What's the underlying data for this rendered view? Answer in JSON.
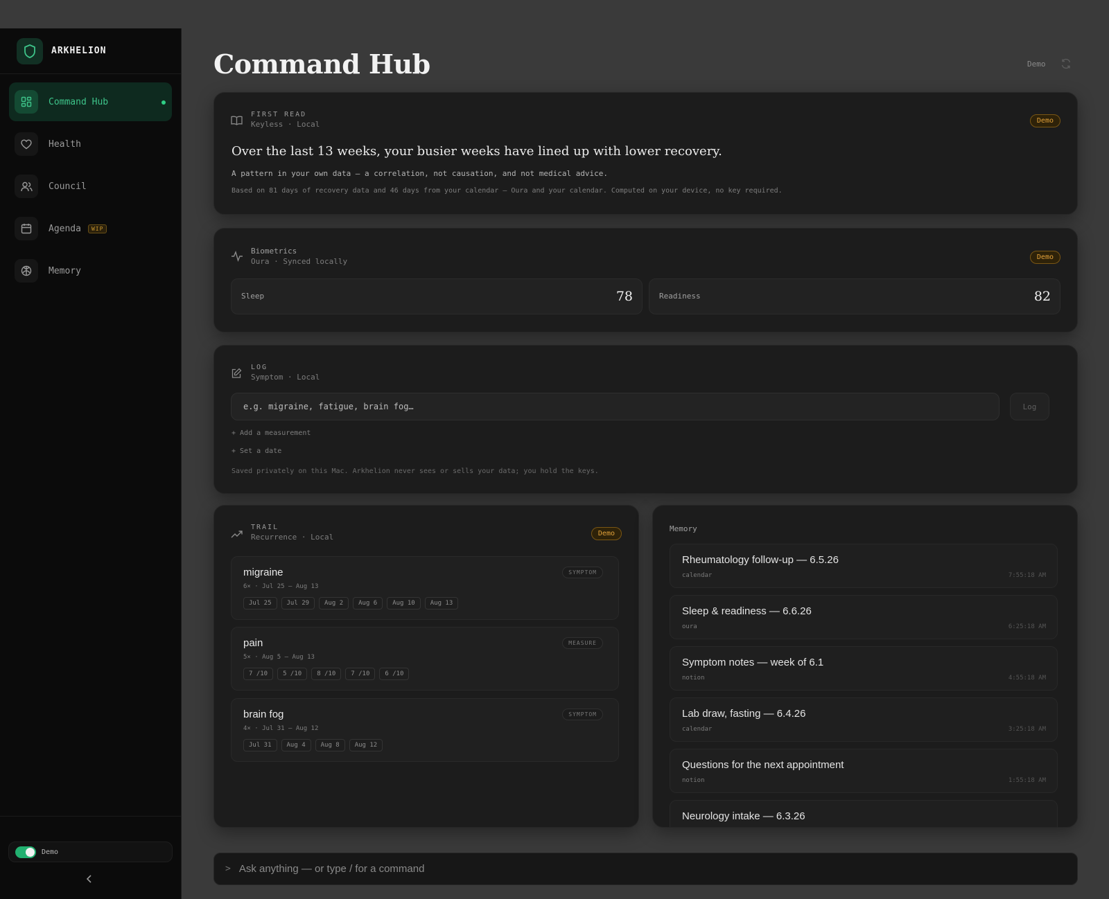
{
  "brand": {
    "name": "ARKHELION"
  },
  "sidebar": {
    "items": [
      {
        "label": "Command Hub",
        "active": true
      },
      {
        "label": "Health"
      },
      {
        "label": "Council"
      },
      {
        "label": "Agenda",
        "badge": "WIP"
      },
      {
        "label": "Memory"
      }
    ],
    "demo_toggle": {
      "label": "Demo",
      "on": true
    }
  },
  "header": {
    "title": "Command Hub",
    "demo_label": "Demo"
  },
  "first_read": {
    "eyebrow": "FIRST READ",
    "sub": "Keyless · Local",
    "badge": "Demo",
    "headline": "Over the last 13 weeks, your busier weeks have lined up with lower recovery.",
    "note": "A pattern in your own data — a correlation, not causation, and not medical advice.",
    "meta": "Based on 81 days of recovery data and 46 days from your calendar — Oura and your calendar. Computed on your device, no key required."
  },
  "biometrics": {
    "title": "Biometrics",
    "sub": "Oura · Synced locally",
    "badge": "Demo",
    "metrics": [
      {
        "label": "Sleep",
        "value": "78"
      },
      {
        "label": "Readiness",
        "value": "82"
      }
    ]
  },
  "log": {
    "eyebrow": "LOG",
    "sub": "Symptom · Local",
    "placeholder": "e.g. migraine, fatigue, brain fog…",
    "button": "Log",
    "add_measurement": "+ Add a measurement",
    "set_date": "+ Set a date",
    "footer": "Saved privately on this Mac. Arkhelion never sees or sells your data; you hold the keys."
  },
  "trail": {
    "eyebrow": "TRAIL",
    "sub": "Recurrence · Local",
    "badge": "Demo",
    "items": [
      {
        "name": "migraine",
        "kind": "SYMPTOM",
        "range": "6× · Jul 25 — Aug 13",
        "chips": [
          "Jul 25",
          "Jul 29",
          "Aug 2",
          "Aug 6",
          "Aug 10",
          "Aug 13"
        ]
      },
      {
        "name": "pain",
        "kind": "MEASURE",
        "range": "5× · Aug 5 — Aug 13",
        "chips": [
          "7 /10",
          "5 /10",
          "8 /10",
          "7 /10",
          "6 /10"
        ]
      },
      {
        "name": "brain fog",
        "kind": "SYMPTOM",
        "range": "4× · Jul 31 — Aug 12",
        "chips": [
          "Jul 31",
          "Aug 4",
          "Aug 8",
          "Aug 12"
        ]
      }
    ]
  },
  "memory": {
    "title": "Memory",
    "items": [
      {
        "title": "Rheumatology follow-up — 6.5.26",
        "source": "calendar",
        "time": "7:55:18 AM"
      },
      {
        "title": "Sleep & readiness — 6.6.26",
        "source": "oura",
        "time": "6:25:18 AM"
      },
      {
        "title": "Symptom notes — week of 6.1",
        "source": "notion",
        "time": "4:55:18 AM"
      },
      {
        "title": "Lab draw, fasting — 6.4.26",
        "source": "calendar",
        "time": "3:25:18 AM"
      },
      {
        "title": "Questions for the next appointment",
        "source": "notion",
        "time": "1:55:18 AM"
      },
      {
        "title": "Neurology intake — 6.3.26",
        "source": "",
        "time": ""
      }
    ]
  },
  "ask": {
    "prompt": ">",
    "placeholder": "Ask anything — or type / for a command"
  },
  "colors": {
    "accent": "#2fcf86",
    "badge": "#e3a23a",
    "background": "#1c1c1c"
  }
}
